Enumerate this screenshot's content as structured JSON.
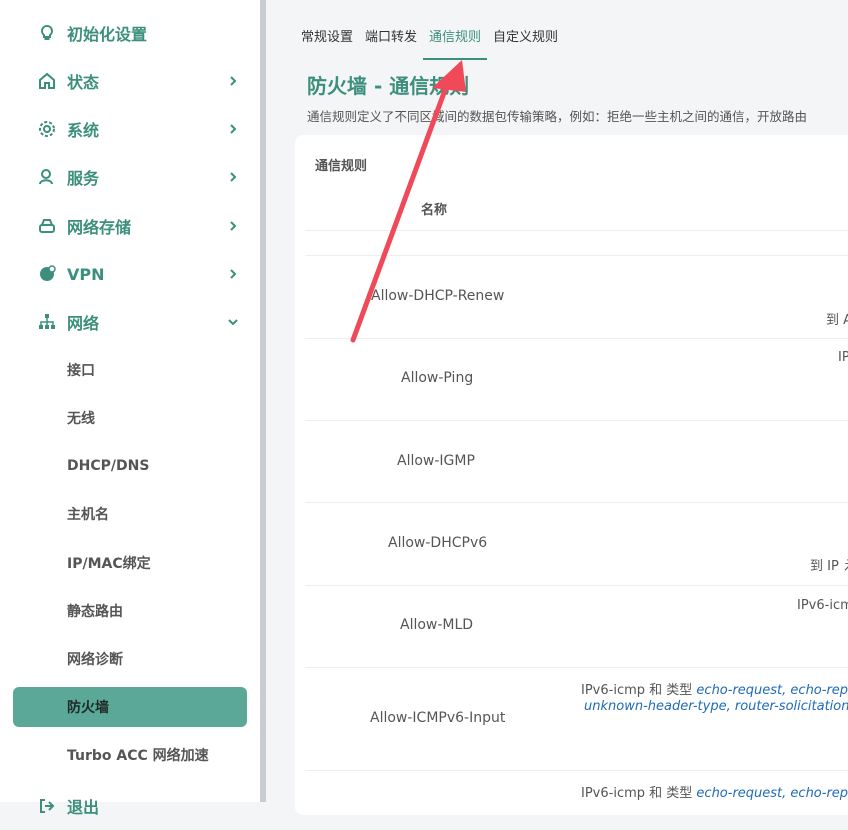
{
  "sidebar": {
    "menu": [
      {
        "label": "初始化设置",
        "icon": "bulb-icon",
        "has_chevron": false
      },
      {
        "label": "状态",
        "icon": "home-icon",
        "has_chevron": true
      },
      {
        "label": "系统",
        "icon": "gear-icon",
        "has_chevron": true
      },
      {
        "label": "服务",
        "icon": "user-service-icon",
        "has_chevron": true
      },
      {
        "label": "网络存储",
        "icon": "storage-icon",
        "has_chevron": true
      },
      {
        "label": "VPN",
        "icon": "globe-icon",
        "has_chevron": true
      },
      {
        "label": "网络",
        "icon": "network-icon",
        "has_chevron": true,
        "expanded": true
      }
    ],
    "submenu": [
      {
        "label": "接口"
      },
      {
        "label": "无线"
      },
      {
        "label": "DHCP/DNS"
      },
      {
        "label": "主机名"
      },
      {
        "label": "IP/MAC绑定"
      },
      {
        "label": "静态路由"
      },
      {
        "label": "网络诊断"
      },
      {
        "label": "防火墙",
        "active": true
      },
      {
        "label": "Turbo ACC 网络加速"
      }
    ],
    "bottom_item": {
      "label": "退出"
    }
  },
  "tabs": [
    {
      "label": "常规设置"
    },
    {
      "label": "端口转发"
    },
    {
      "label": "通信规则",
      "active": true
    },
    {
      "label": "自定义规则"
    }
  ],
  "page": {
    "title": "防火墙 - 通信规则",
    "description": "通信规则定义了不同区域间的数据包传输策略，例如：拒绝一些主机之间的通信，开放路由"
  },
  "table": {
    "section_title": "通信规则",
    "col_name": "名称",
    "rows": [
      {
        "name": "Allow-DHCP-Renew",
        "detail": "到 A"
      },
      {
        "name": "Allow-Ping",
        "detail": "IP"
      },
      {
        "name": "Allow-IGMP",
        "detail": ""
      },
      {
        "name": "Allow-DHCPv6",
        "detail": "到 IP え"
      },
      {
        "name": "Allow-MLD",
        "detail": "IPv6-icm"
      },
      {
        "name": "Allow-ICMPv6-Input",
        "detail_prefix": "IPv6-icmp 和 类型",
        "types_line1": "echo-request, echo-reply",
        "types_line2": "unknown-header-type, router-solicitation,"
      },
      {
        "name": "",
        "detail_prefix": "IPv6-icmp 和 类型",
        "types_line1": "echo-request, echo-reply"
      }
    ]
  },
  "colors": {
    "accent": "#3c8f7d",
    "active_bg": "#5ba898",
    "arrow": "#f04a5a",
    "link": "#1e6bb8"
  }
}
